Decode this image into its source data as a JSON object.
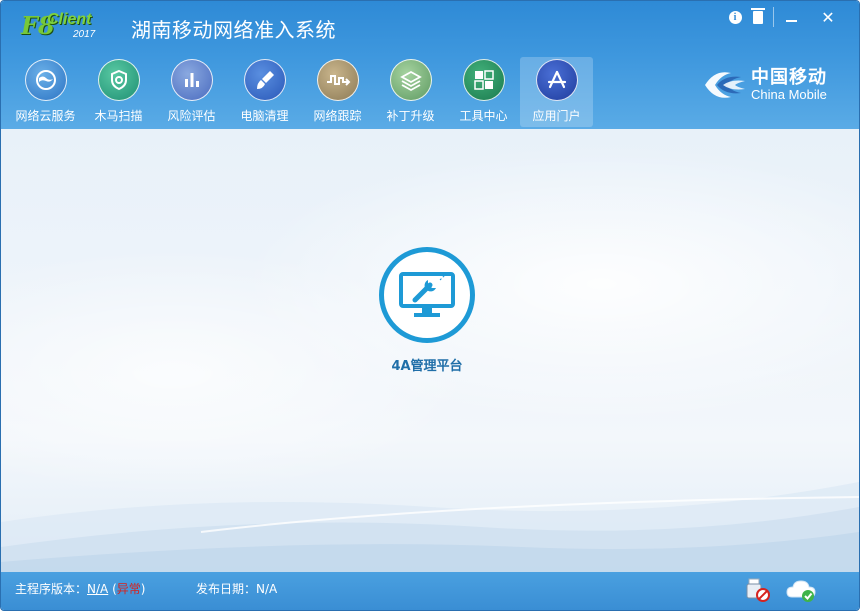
{
  "app": {
    "logo_main": "F8",
    "logo_sub": "Client",
    "logo_year": "2017",
    "title": "湖南移动网络准入系统"
  },
  "window_controls": {
    "info_glyph": "i",
    "close_glyph": "✕"
  },
  "toolbar": {
    "items": [
      {
        "label": "网络云服务",
        "icon": "cloud-globe-icon"
      },
      {
        "label": "木马扫描",
        "icon": "shield-scan-icon"
      },
      {
        "label": "风险评估",
        "icon": "bar-chart-icon"
      },
      {
        "label": "电脑清理",
        "icon": "brush-icon"
      },
      {
        "label": "网络跟踪",
        "icon": "signal-trace-icon"
      },
      {
        "label": "补丁升级",
        "icon": "layers-icon"
      },
      {
        "label": "工具中心",
        "icon": "tools-grid-icon"
      },
      {
        "label": "应用门户",
        "icon": "app-store-icon",
        "active": true
      }
    ]
  },
  "brand": {
    "name_cn": "中国移动",
    "name_en": "China Mobile"
  },
  "main": {
    "apps": [
      {
        "label": "4A管理平台",
        "icon": "monitor-wrench-icon"
      }
    ]
  },
  "status": {
    "version_label": "主程序版本：",
    "version_value": "N/A",
    "paren_open": "(",
    "version_state": "异常",
    "paren_close": ")",
    "date_label": "发布日期：",
    "date_value": "N/A"
  },
  "colors": {
    "header": "#3f98de",
    "accent": "#1e9ad6",
    "error": "#d6221e"
  }
}
